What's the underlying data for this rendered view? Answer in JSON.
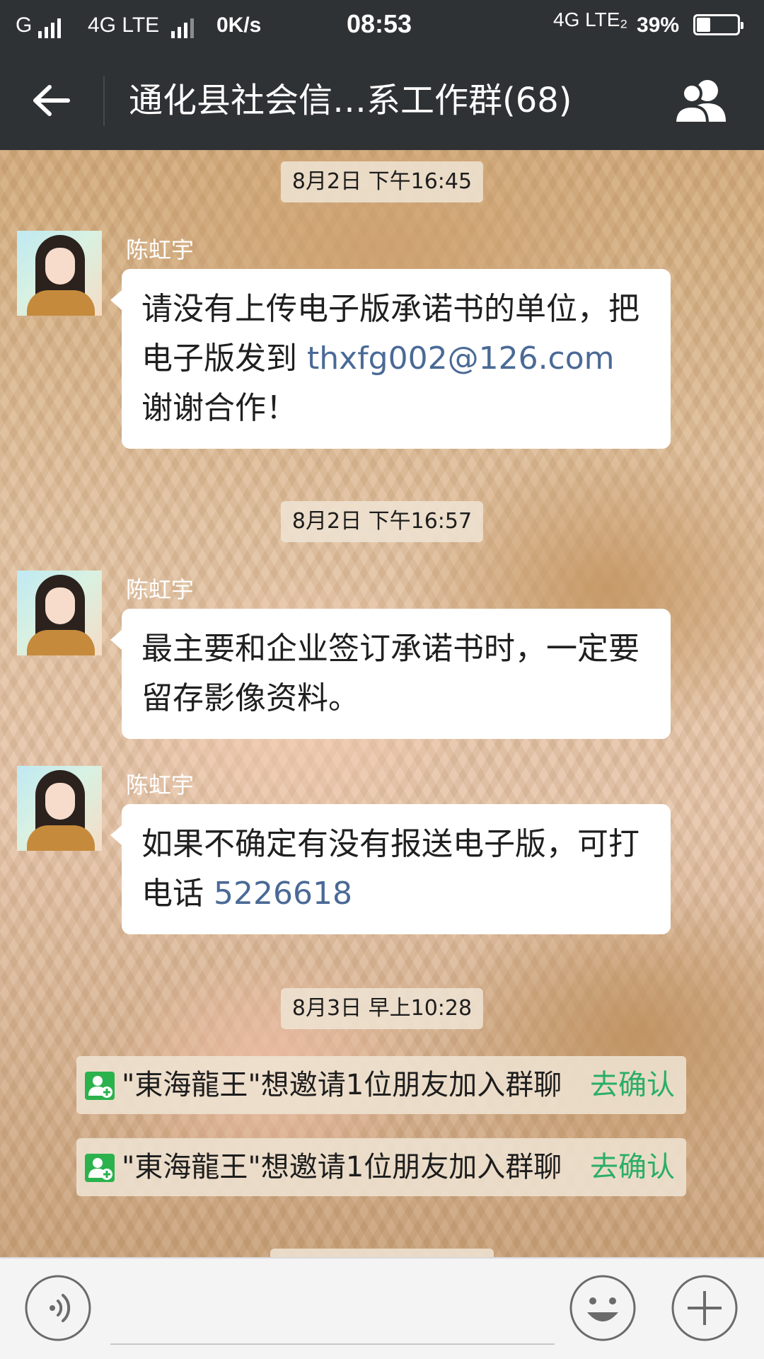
{
  "status_bar": {
    "carrier1": "G",
    "carrier2": "4G LTE",
    "speed": "0K/s",
    "time": "08:53",
    "network_right": "4G LTE₂",
    "battery_percent": "39%",
    "battery_level": 0.39
  },
  "header": {
    "title": "通化县社会信…系工作群(68)",
    "back_icon": "arrow-left-icon",
    "members_icon": "group-members-icon"
  },
  "chat": {
    "timestamps": [
      "8月2日 下午16:45",
      "8月2日 下午16:57",
      "8月3日 早上10:28"
    ],
    "messages": [
      {
        "sender": "陈虹宇",
        "parts": [
          "请没有上传电子版承诺书的单位，把电子版发到 ",
          "thxfg002@126.com",
          "谢谢合作！"
        ]
      },
      {
        "sender": "陈虹宇",
        "parts": [
          "最主要和企业签订承诺书时，一定要留存影像资料。"
        ]
      },
      {
        "sender": "陈虹宇",
        "parts": [
          "如果不确定有没有报送电子版，可打电话 ",
          "5226618"
        ]
      }
    ],
    "system_notices": [
      {
        "text": "\"東海龍王\"想邀请1位朋友加入群聊",
        "action": "去确认"
      },
      {
        "text": "\"東海龍王\"想邀请1位朋友加入群聊",
        "action": "去确认"
      }
    ]
  },
  "input_bar": {
    "voice_icon": "voice-icon",
    "emoji_icon": "emoji-icon",
    "more_icon": "plus-icon",
    "input_value": "",
    "input_placeholder": ""
  },
  "colors": {
    "bar_bg": "#2f3235",
    "link": "#4a6a96",
    "confirm_green": "#2aae67",
    "add_icon_green": "#2bb24c"
  }
}
